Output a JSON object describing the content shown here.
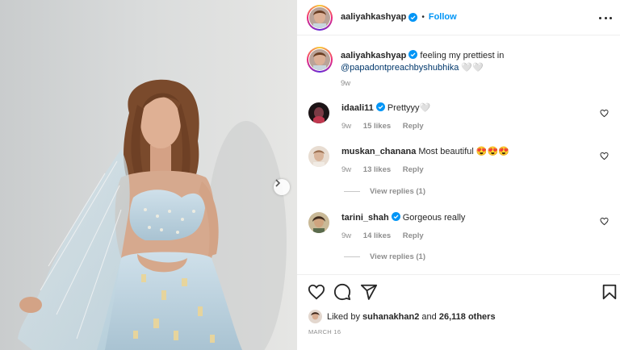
{
  "post": {
    "author": "aaliyahkashyap",
    "follow_label": "Follow",
    "separator": "•",
    "caption_author": "aaliyahkashyap",
    "caption_text": "feeling my prettiest in",
    "caption_mention": "@papadontpreachbyshubhika",
    "caption_emoji": "🤍🤍",
    "caption_age": "9w"
  },
  "comments": [
    {
      "user": "idaali11",
      "verified": true,
      "text": "Prettyyy🤍",
      "age": "9w",
      "likes": "15 likes",
      "reply": "Reply"
    },
    {
      "user": "muskan_chanana",
      "verified": false,
      "text": "Most beautiful 😍😍😍",
      "age": "9w",
      "likes": "13 likes",
      "reply": "Reply",
      "view_replies": "View replies (1)"
    },
    {
      "user": "tarini_shah",
      "verified": true,
      "text": "Gorgeous really",
      "age": "9w",
      "likes": "14 likes",
      "reply": "Reply",
      "view_replies": "View replies (1)"
    }
  ],
  "footer": {
    "liked_by_prefix": "Liked by",
    "liked_by_user": "suhanakhan2",
    "liked_by_and": "and",
    "liked_by_count": "26,118 others",
    "date": "MARCH 16"
  },
  "icons": {
    "like": "heart-icon",
    "comment": "comment-icon",
    "share": "share-icon",
    "save": "bookmark-icon",
    "more": "more-options-icon",
    "next": "chevron-right-icon"
  },
  "colors": {
    "follow": "#0095f6",
    "verified": "#0095f6",
    "mention": "#00376b",
    "muted": "#8e8e8e"
  }
}
